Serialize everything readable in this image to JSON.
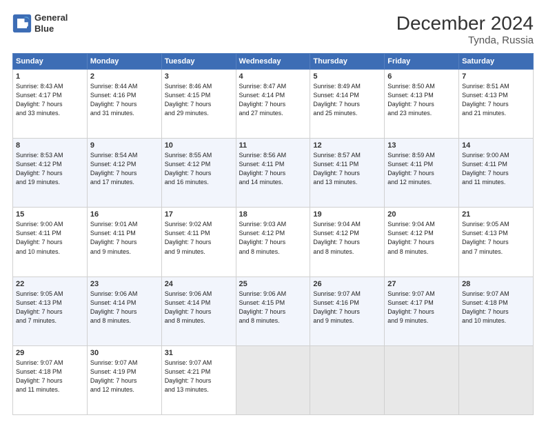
{
  "header": {
    "logo_line1": "General",
    "logo_line2": "Blue",
    "title": "December 2024",
    "subtitle": "Tynda, Russia"
  },
  "days_of_week": [
    "Sunday",
    "Monday",
    "Tuesday",
    "Wednesday",
    "Thursday",
    "Friday",
    "Saturday"
  ],
  "weeks": [
    [
      {
        "day": 1,
        "info": "Sunrise: 8:43 AM\nSunset: 4:17 PM\nDaylight: 7 hours\nand 33 minutes."
      },
      {
        "day": 2,
        "info": "Sunrise: 8:44 AM\nSunset: 4:16 PM\nDaylight: 7 hours\nand 31 minutes."
      },
      {
        "day": 3,
        "info": "Sunrise: 8:46 AM\nSunset: 4:15 PM\nDaylight: 7 hours\nand 29 minutes."
      },
      {
        "day": 4,
        "info": "Sunrise: 8:47 AM\nSunset: 4:14 PM\nDaylight: 7 hours\nand 27 minutes."
      },
      {
        "day": 5,
        "info": "Sunrise: 8:49 AM\nSunset: 4:14 PM\nDaylight: 7 hours\nand 25 minutes."
      },
      {
        "day": 6,
        "info": "Sunrise: 8:50 AM\nSunset: 4:13 PM\nDaylight: 7 hours\nand 23 minutes."
      },
      {
        "day": 7,
        "info": "Sunrise: 8:51 AM\nSunset: 4:13 PM\nDaylight: 7 hours\nand 21 minutes."
      }
    ],
    [
      {
        "day": 8,
        "info": "Sunrise: 8:53 AM\nSunset: 4:12 PM\nDaylight: 7 hours\nand 19 minutes."
      },
      {
        "day": 9,
        "info": "Sunrise: 8:54 AM\nSunset: 4:12 PM\nDaylight: 7 hours\nand 17 minutes."
      },
      {
        "day": 10,
        "info": "Sunrise: 8:55 AM\nSunset: 4:12 PM\nDaylight: 7 hours\nand 16 minutes."
      },
      {
        "day": 11,
        "info": "Sunrise: 8:56 AM\nSunset: 4:11 PM\nDaylight: 7 hours\nand 14 minutes."
      },
      {
        "day": 12,
        "info": "Sunrise: 8:57 AM\nSunset: 4:11 PM\nDaylight: 7 hours\nand 13 minutes."
      },
      {
        "day": 13,
        "info": "Sunrise: 8:59 AM\nSunset: 4:11 PM\nDaylight: 7 hours\nand 12 minutes."
      },
      {
        "day": 14,
        "info": "Sunrise: 9:00 AM\nSunset: 4:11 PM\nDaylight: 7 hours\nand 11 minutes."
      }
    ],
    [
      {
        "day": 15,
        "info": "Sunrise: 9:00 AM\nSunset: 4:11 PM\nDaylight: 7 hours\nand 10 minutes."
      },
      {
        "day": 16,
        "info": "Sunrise: 9:01 AM\nSunset: 4:11 PM\nDaylight: 7 hours\nand 9 minutes."
      },
      {
        "day": 17,
        "info": "Sunrise: 9:02 AM\nSunset: 4:11 PM\nDaylight: 7 hours\nand 9 minutes."
      },
      {
        "day": 18,
        "info": "Sunrise: 9:03 AM\nSunset: 4:12 PM\nDaylight: 7 hours\nand 8 minutes."
      },
      {
        "day": 19,
        "info": "Sunrise: 9:04 AM\nSunset: 4:12 PM\nDaylight: 7 hours\nand 8 minutes."
      },
      {
        "day": 20,
        "info": "Sunrise: 9:04 AM\nSunset: 4:12 PM\nDaylight: 7 hours\nand 8 minutes."
      },
      {
        "day": 21,
        "info": "Sunrise: 9:05 AM\nSunset: 4:13 PM\nDaylight: 7 hours\nand 7 minutes."
      }
    ],
    [
      {
        "day": 22,
        "info": "Sunrise: 9:05 AM\nSunset: 4:13 PM\nDaylight: 7 hours\nand 7 minutes."
      },
      {
        "day": 23,
        "info": "Sunrise: 9:06 AM\nSunset: 4:14 PM\nDaylight: 7 hours\nand 8 minutes."
      },
      {
        "day": 24,
        "info": "Sunrise: 9:06 AM\nSunset: 4:14 PM\nDaylight: 7 hours\nand 8 minutes."
      },
      {
        "day": 25,
        "info": "Sunrise: 9:06 AM\nSunset: 4:15 PM\nDaylight: 7 hours\nand 8 minutes."
      },
      {
        "day": 26,
        "info": "Sunrise: 9:07 AM\nSunset: 4:16 PM\nDaylight: 7 hours\nand 9 minutes."
      },
      {
        "day": 27,
        "info": "Sunrise: 9:07 AM\nSunset: 4:17 PM\nDaylight: 7 hours\nand 9 minutes."
      },
      {
        "day": 28,
        "info": "Sunrise: 9:07 AM\nSunset: 4:18 PM\nDaylight: 7 hours\nand 10 minutes."
      }
    ],
    [
      {
        "day": 29,
        "info": "Sunrise: 9:07 AM\nSunset: 4:18 PM\nDaylight: 7 hours\nand 11 minutes."
      },
      {
        "day": 30,
        "info": "Sunrise: 9:07 AM\nSunset: 4:19 PM\nDaylight: 7 hours\nand 12 minutes."
      },
      {
        "day": 31,
        "info": "Sunrise: 9:07 AM\nSunset: 4:21 PM\nDaylight: 7 hours\nand 13 minutes."
      },
      null,
      null,
      null,
      null
    ]
  ]
}
